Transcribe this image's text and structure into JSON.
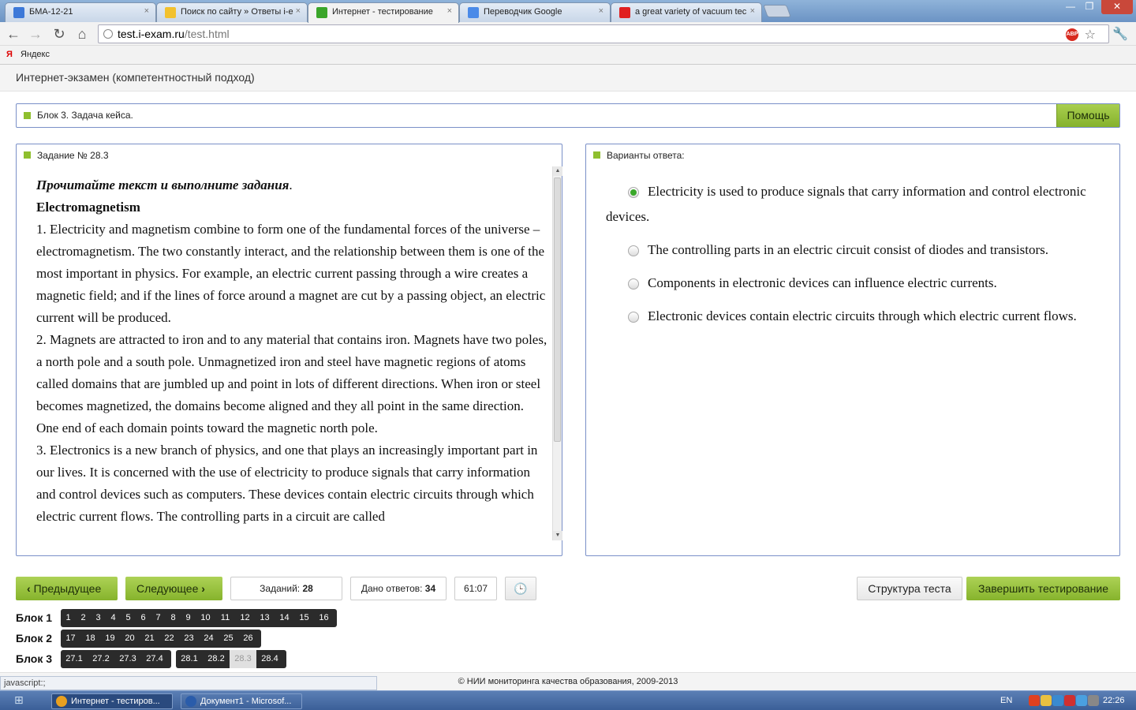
{
  "browser": {
    "tabs": [
      {
        "title": "БМА-12-21",
        "icon_color": "#3c78d8"
      },
      {
        "title": "Поиск по сайту » Ответы i-e",
        "icon_color": "#f2c12e"
      },
      {
        "title": "Интернет - тестирование",
        "icon_color": "#3aa52a",
        "active": true
      },
      {
        "title": "Переводчик Google",
        "icon_color": "#4a8ae8"
      },
      {
        "title": "a great variety of vacuum tec",
        "icon_color": "#e02020"
      }
    ],
    "close_glyph": "×",
    "window_controls": [
      "—",
      "❐",
      "✕"
    ],
    "nav": {
      "back": "←",
      "forward": "→",
      "reload": "↻",
      "home": "⌂"
    },
    "url": {
      "domain": "test.i-exam.ru",
      "path": "/test.html"
    },
    "abp_label": "ABP",
    "star_glyph": "☆",
    "wrench_glyph": "🔧",
    "bookmark": {
      "icon": "Я",
      "label": "Яндекс"
    }
  },
  "page": {
    "header_title": "Интернет-экзамен (компетентностный подход)",
    "block_title": "Блок 3. Задача кейса.",
    "help_label": "Помощь",
    "task": {
      "title": "Задание № 28.3",
      "intro": "Прочитайте текст и выполните задания",
      "intro_dot": ".",
      "heading": "Electromagnetism",
      "paragraphs": [
        "1. Electricity and magnetism combine to form one of the fundamental forces of the universe – electromagnetism. The two constantly interact, and the relationship between them is one of the most important in physics. For example, an electric current passing through a wire creates a magnetic field; and if the lines of force around a magnet are cut by a passing object, an electric current will be produced.",
        "2. Magnets are attracted to iron and to any material that contains iron. Magnets have two poles, a north pole and a south pole. Unmagnetized iron and steel have magnetic regions of atoms called domains that are jumbled up and point in lots of different directions. When iron or steel becomes magnetized, the domains become aligned and they all point in the same direction. One end of each domain points toward the magnetic north pole.",
        "3. Electronics is a new branch of physics, and one that plays an increasingly important part in our lives. It is concerned with the use of electricity to produce signals that carry information and control devices such as computers. These devices contain electric circuits through which electric current flows. The controlling parts in a circuit are called"
      ]
    },
    "answers": {
      "title": "Варианты ответа:",
      "options": [
        {
          "text": "Electricity is used to produce signals that carry information and control electronic devices.",
          "checked": true
        },
        {
          "text": "The controlling parts in an electric circuit consist of diodes and transistors.",
          "checked": false
        },
        {
          "text": "Components in electronic devices can influence electric currents.",
          "checked": false
        },
        {
          "text": "Electronic devices contain electric circuits through which electric current flows.",
          "checked": false
        }
      ]
    },
    "controls": {
      "prev_label": "Предыдущее",
      "next_label": "Следующее",
      "tasks_label": "Заданий:",
      "tasks_count": "28",
      "answered_label": "Дано ответов:",
      "answered_count": "34",
      "timer": "61:07",
      "clock_glyph": "🕒",
      "structure_label": "Структура теста",
      "finish_label": "Завершить тестирование"
    },
    "blocks": [
      {
        "label": "Блок 1",
        "groups": [
          [
            "1",
            "2",
            "3",
            "4",
            "5",
            "6",
            "7",
            "8",
            "9",
            "10",
            "11",
            "12",
            "13",
            "14",
            "15",
            "16"
          ]
        ]
      },
      {
        "label": "Блок 2",
        "groups": [
          [
            "17",
            "18",
            "19",
            "20",
            "21",
            "22",
            "23",
            "24",
            "25",
            "26"
          ]
        ]
      },
      {
        "label": "Блок 3",
        "groups": [
          [
            "27.1",
            "27.2",
            "27.3",
            "27.4"
          ],
          [
            "28.1",
            "28.2",
            "28.3",
            "28.4"
          ]
        ]
      }
    ],
    "current_question": "28.3",
    "footer": "© НИИ мониторинга качества образования, 2009-2013",
    "status_text": "javascript:;"
  },
  "taskbar": {
    "start_glyph": "⊞",
    "tasks": [
      {
        "title": "Интернет - тестиров...",
        "active": true,
        "icon_color": "#e8a020"
      },
      {
        "title": "Документ1 - Microsof...",
        "active": false,
        "icon_color": "#2a5caa"
      }
    ],
    "lang": "EN",
    "tray_colors": [
      "#e04020",
      "#e8c040",
      "#3a8ad0",
      "#d03030",
      "#4aa0e0",
      "#888888"
    ],
    "time": "22:26"
  }
}
